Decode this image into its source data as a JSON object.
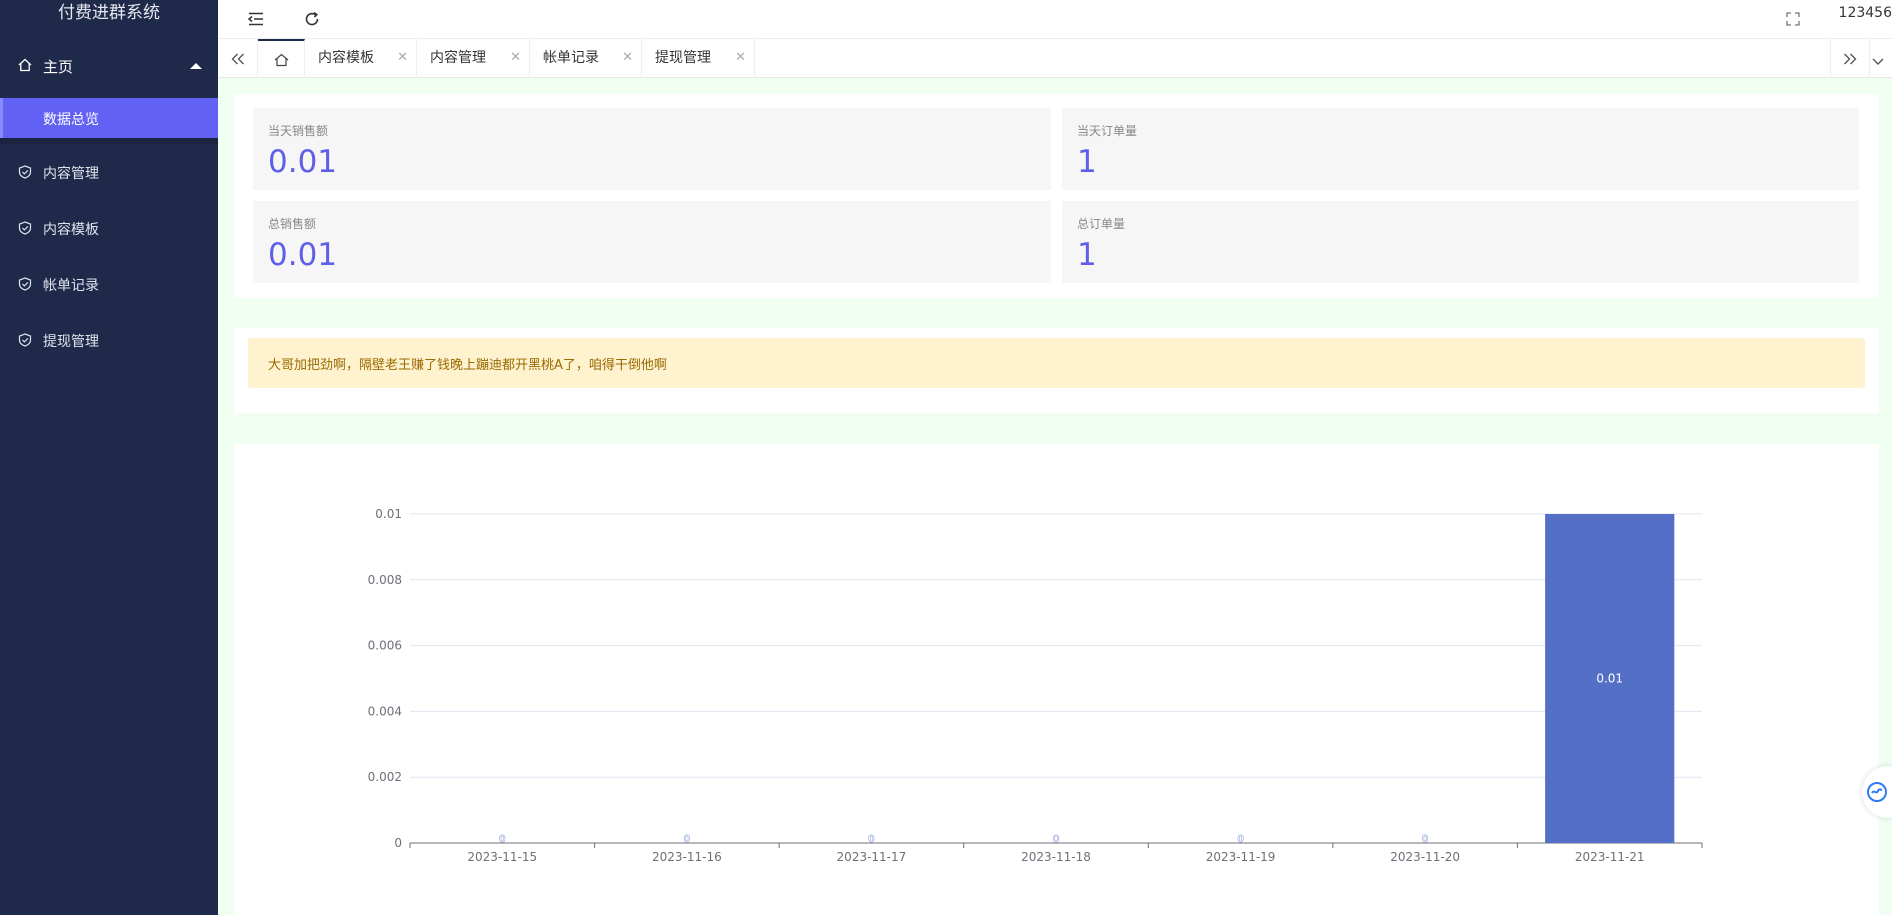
{
  "app": {
    "title": "付费进群系统"
  },
  "sidebar": {
    "group": {
      "label": "主页",
      "icon": "home-icon"
    },
    "sub_active": {
      "label": "数据总览"
    },
    "items": [
      {
        "label": "内容管理",
        "icon": "shield-check-icon"
      },
      {
        "label": "内容模板",
        "icon": "shield-check-icon"
      },
      {
        "label": "帐单记录",
        "icon": "shield-check-icon"
      },
      {
        "label": "提现管理",
        "icon": "shield-check-icon"
      }
    ]
  },
  "header": {
    "user": "123456",
    "icons": [
      "menu-fold-icon",
      "refresh-icon",
      "fullscreen-icon"
    ]
  },
  "tabs": [
    {
      "label": "内容模板"
    },
    {
      "label": "内容管理"
    },
    {
      "label": "帐单记录"
    },
    {
      "label": "提现管理"
    }
  ],
  "stats": [
    {
      "title": "当天销售额",
      "value": "0.01"
    },
    {
      "title": "当天订单量",
      "value": "1"
    },
    {
      "title": "总销售额",
      "value": "0.01"
    },
    {
      "title": "总订单量",
      "value": "1"
    }
  ],
  "notice": {
    "text": "大哥加把劲啊，隔壁老王赚了钱晚上蹦迪都开黑桃A了，咱得干倒他啊"
  },
  "colors": {
    "sidebar_bg": "#1f2a4a",
    "accent": "#6161f4",
    "stat_value": "#5f5fe9",
    "bar": "#5470c6",
    "notice_bg": "#fff2cf"
  },
  "chart_data": {
    "type": "bar",
    "categories": [
      "2023-11-15",
      "2023-11-16",
      "2023-11-17",
      "2023-11-18",
      "2023-11-19",
      "2023-11-20",
      "2023-11-21"
    ],
    "series": [
      {
        "values": [
          0,
          0,
          0,
          0,
          0,
          0,
          0.01
        ]
      }
    ],
    "data_labels": [
      "0",
      "0",
      "0",
      "0",
      "0",
      "0",
      "0.01"
    ],
    "ylim": [
      0,
      0.01
    ],
    "yticks": [
      "0",
      "0.002",
      "0.004",
      "0.006",
      "0.008",
      "0.01"
    ],
    "ytick_values": [
      0,
      0.002,
      0.004,
      0.006,
      0.008,
      0.01
    ],
    "grid": true,
    "title": "",
    "xlabel": "",
    "ylabel": ""
  }
}
